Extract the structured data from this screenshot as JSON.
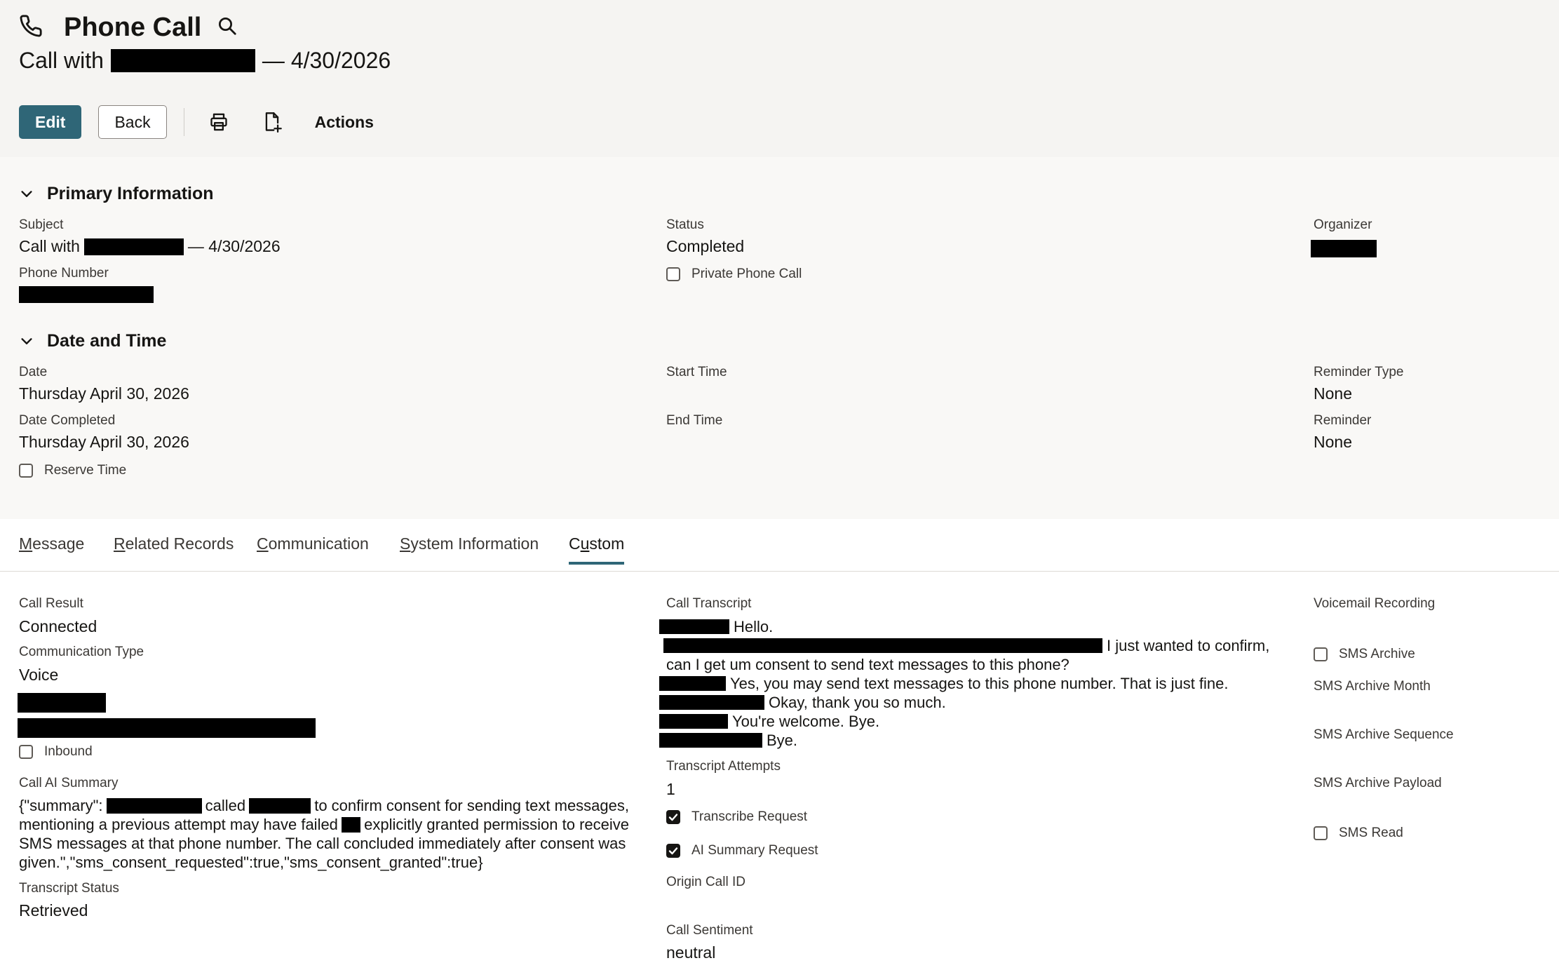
{
  "header": {
    "page_title": "Phone Call",
    "subtitle_prefix": "Call with",
    "subtitle_suffix": "— 4/30/2026"
  },
  "toolbar": {
    "edit_label": "Edit",
    "back_label": "Back",
    "actions_label": "Actions"
  },
  "primary": {
    "section_title": "Primary Information",
    "subject_label": "Subject",
    "subject_prefix": "Call with",
    "subject_suffix": "— 4/30/2026",
    "phone_label": "Phone Number",
    "status_label": "Status",
    "status_value": "Completed",
    "private_label": "Private Phone Call",
    "organizer_label": "Organizer"
  },
  "datetime": {
    "section_title": "Date and Time",
    "date_label": "Date",
    "date_value": "Thursday April 30, 2026",
    "date_completed_label": "Date Completed",
    "date_completed_value": "Thursday April 30, 2026",
    "reserve_label": "Reserve Time",
    "start_label": "Start Time",
    "end_label": "End Time",
    "reminder_type_label": "Reminder Type",
    "reminder_type_value": "None",
    "reminder_label": "Reminder",
    "reminder_value": "None"
  },
  "tabs": [
    {
      "first": "M",
      "rest": "essage"
    },
    {
      "first": "R",
      "rest": "elated Records"
    },
    {
      "first": "C",
      "rest": "ommunication"
    },
    {
      "first": "S",
      "rest": "ystem Information"
    },
    {
      "first": "",
      "mid_before": "C",
      "ul": "u",
      "rest": "stom"
    }
  ],
  "custom": {
    "call_result_label": "Call Result",
    "call_result_value": "Connected",
    "comm_type_label": "Communication Type",
    "comm_type_value": "Voice",
    "inbound_label": "Inbound",
    "ai_summary_label": "Call AI Summary",
    "summary_part1": "{\"summary\":",
    "summary_part2": "called",
    "summary_part3": "to confirm consent for sending text messages,",
    "summary_line2a": "mentioning a previous attempt may have failed",
    "summary_line2b": "explicitly granted permission to receive",
    "summary_line3": "SMS messages at that phone number. The call concluded immediately after consent was",
    "summary_line4": "given.\",\"sms_consent_requested\":true,\"sms_consent_granted\":true}",
    "transcript_status_label": "Transcript Status",
    "transcript_status_value": "Retrieved",
    "call_transcript_label": "Call Transcript",
    "transcript_lines": [
      "Hello.",
      "I just wanted to confirm,",
      "can I get um consent to send text messages to this phone?",
      "Yes, you may send text messages to this phone number. That is just fine.",
      "Okay, thank you so much.",
      "You're welcome. Bye.",
      "Bye."
    ],
    "transcript_attempts_label": "Transcript Attempts",
    "transcript_attempts_value": "1",
    "transcribe_request_label": "Transcribe Request",
    "ai_summary_request_label": "AI Summary Request",
    "origin_call_id_label": "Origin Call ID",
    "call_sentiment_label": "Call Sentiment",
    "call_sentiment_value": "neutral",
    "voicemail_label": "Voicemail Recording",
    "sms_archive_label": "SMS Archive",
    "sms_archive_month_label": "SMS Archive Month",
    "sms_archive_sequence_label": "SMS Archive Sequence",
    "sms_archive_payload_label": "SMS Archive Payload",
    "sms_read_label": "SMS Read"
  },
  "colors": {
    "primary_button": "#2f6677",
    "header_bg": "#f5f4f2",
    "tab_active": "#2f6677"
  }
}
